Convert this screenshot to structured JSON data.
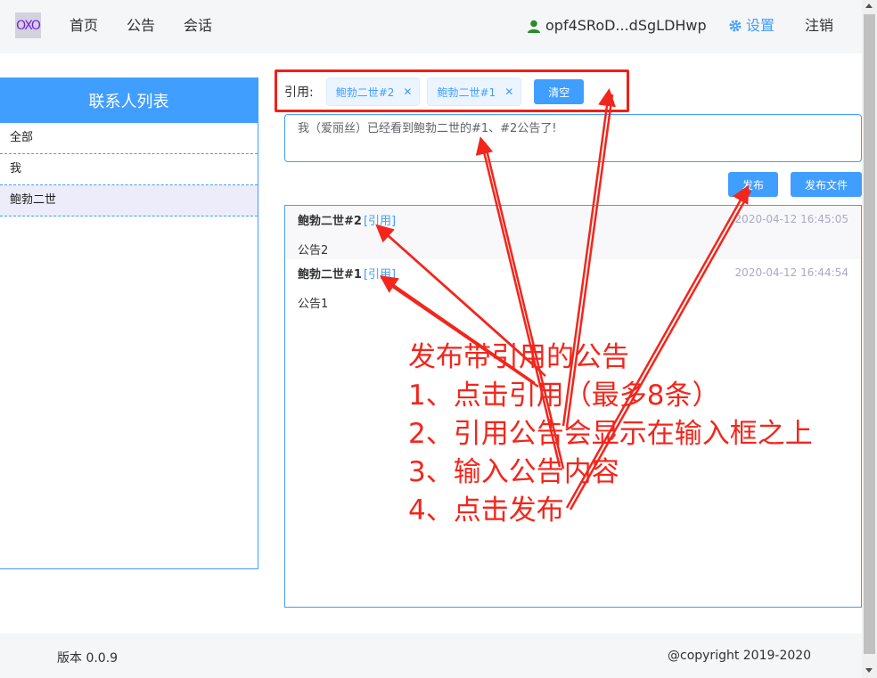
{
  "nav": {
    "logo": "OXO",
    "links": [
      "首页",
      "公告",
      "会话"
    ],
    "user": "opf4SRoD...dSgLDHwp",
    "settings": "设置",
    "logout": "注销"
  },
  "contacts": {
    "title": "联系人列表",
    "items": [
      "全部",
      "我",
      "鲍勃二世"
    ],
    "active_index": 2
  },
  "quote": {
    "label": "引用:",
    "tags": [
      "鲍勃二世#2",
      "鲍勃二世#1"
    ],
    "clear_label": "清空"
  },
  "input": {
    "value": "我（爱丽丝）已经看到鲍勃二世的#1、#2公告了!"
  },
  "actions": {
    "publish_label": "发布",
    "publish_file_label": "发布文件"
  },
  "posts": [
    {
      "author": "鲍勃二世#2",
      "quote_label": "[引用]",
      "time": "2020-04-12 16:45:05",
      "content": "公告2"
    },
    {
      "author": "鲍勃二世#1",
      "quote_label": "[引用]",
      "time": "2020-04-12 16:44:54",
      "content": "公告1"
    }
  ],
  "footer": {
    "version": "版本 0.0.9",
    "copyright": "@copyright 2019-2020"
  },
  "annotation": {
    "lines": [
      "发布带引用的公告",
      "1、点击引用（最多8条）",
      "2、引用公告会显示在输入框之上",
      "3、输入公告内容",
      "4、点击发布"
    ],
    "color": "#f2261c"
  },
  "colors": {
    "accent": "#409eff",
    "annotation": "#f2261c"
  }
}
